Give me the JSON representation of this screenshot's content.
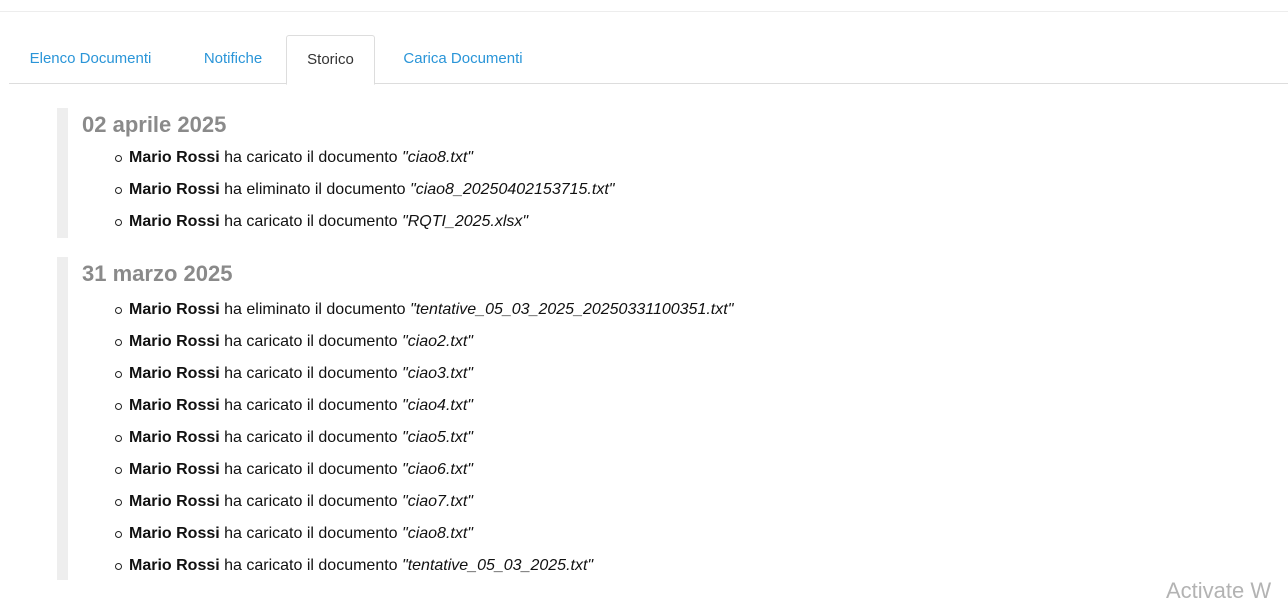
{
  "tabs": [
    {
      "label": "Elenco Documenti",
      "active": false
    },
    {
      "label": "Notifiche",
      "active": false
    },
    {
      "label": "Storico",
      "active": true
    },
    {
      "label": "Carica Documenti",
      "active": false
    }
  ],
  "history": [
    {
      "date": "02 aprile 2025",
      "entries": [
        {
          "user": "Mario Rossi",
          "action": " ha caricato il documento ",
          "doc": "\"ciao8.txt\""
        },
        {
          "user": "Mario Rossi",
          "action": " ha eliminato il documento ",
          "doc": "\"ciao8_20250402153715.txt\""
        },
        {
          "user": "Mario Rossi",
          "action": " ha caricato il documento ",
          "doc": "\"RQTI_2025.xlsx\""
        }
      ]
    },
    {
      "date": "31 marzo 2025",
      "entries": [
        {
          "user": "Mario Rossi",
          "action": " ha eliminato il documento ",
          "doc": "\"tentative_05_03_2025_20250331100351.txt\""
        },
        {
          "user": "Mario Rossi",
          "action": " ha caricato il documento ",
          "doc": "\"ciao2.txt\""
        },
        {
          "user": "Mario Rossi",
          "action": " ha caricato il documento ",
          "doc": "\"ciao3.txt\""
        },
        {
          "user": "Mario Rossi",
          "action": " ha caricato il documento ",
          "doc": "\"ciao4.txt\""
        },
        {
          "user": "Mario Rossi",
          "action": " ha caricato il documento ",
          "doc": "\"ciao5.txt\""
        },
        {
          "user": "Mario Rossi",
          "action": " ha caricato il documento ",
          "doc": "\"ciao6.txt\""
        },
        {
          "user": "Mario Rossi",
          "action": " ha caricato il documento ",
          "doc": "\"ciao7.txt\""
        },
        {
          "user": "Mario Rossi",
          "action": " ha caricato il documento ",
          "doc": "\"ciao8.txt\""
        },
        {
          "user": "Mario Rossi",
          "action": " ha caricato il documento ",
          "doc": "\"tentative_05_03_2025.txt\""
        }
      ]
    }
  ],
  "watermark": "Activate W"
}
